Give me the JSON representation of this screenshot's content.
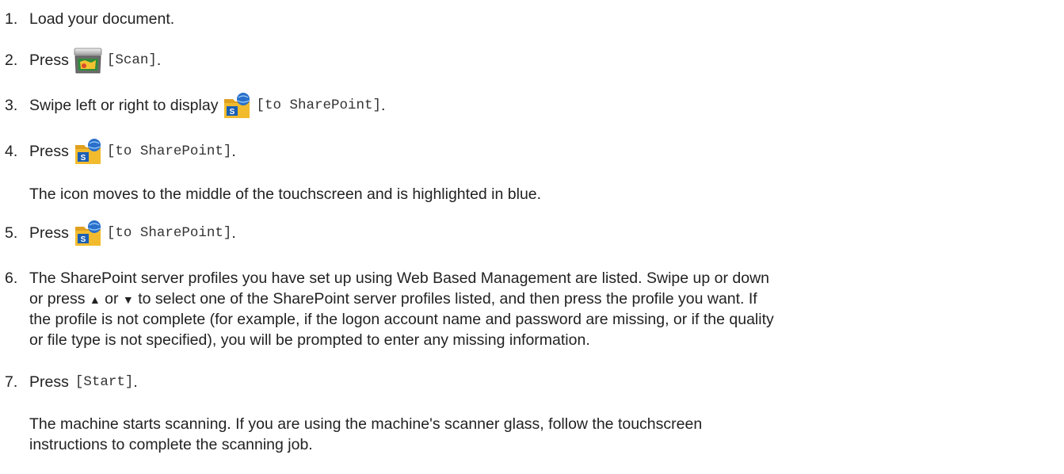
{
  "steps": [
    {
      "num": "1.",
      "text": "Load your document."
    },
    {
      "num": "2.",
      "lead": "Press",
      "icon": "scanner-icon",
      "code": "[Scan]",
      "tail": "."
    },
    {
      "num": "3.",
      "lead": "Swipe left or right to display",
      "icon": "sharepoint-folder-icon",
      "code": "[to SharePoint]",
      "tail": "."
    },
    {
      "num": "4.",
      "lead": "Press",
      "icon": "sharepoint-folder-icon",
      "code": "[to SharePoint]",
      "tail": ".",
      "note": "The icon moves to the middle of the touchscreen and is highlighted in blue."
    },
    {
      "num": "5.",
      "lead": "Press",
      "icon": "sharepoint-folder-icon",
      "code": "[to SharePoint]",
      "tail": "."
    },
    {
      "num": "6.",
      "lines": [
        "The SharePoint server profiles you have set up using Web Based Management are listed. Swipe up or down",
        "to select one of the SharePoint server profiles listed, and then press the profile you want. If",
        "the profile is not complete (for example, if the logon account name and password are missing, or if the quality",
        "or file type is not specified), you will be prompted to enter any missing information."
      ],
      "line2_prefix": "or press",
      "up_arrow": "▲",
      "or_word": "or",
      "down_arrow": "▼",
      "line2_rest": "to select one of the SharePoint server profiles listed, and then press the profile you want. If"
    },
    {
      "num": "7.",
      "lead": "Press",
      "code": "[Start]",
      "tail": ".",
      "note_lines": [
        "The machine starts scanning. If you are using the machine's scanner glass, follow the touchscreen",
        "instructions to complete the scanning job."
      ]
    }
  ]
}
